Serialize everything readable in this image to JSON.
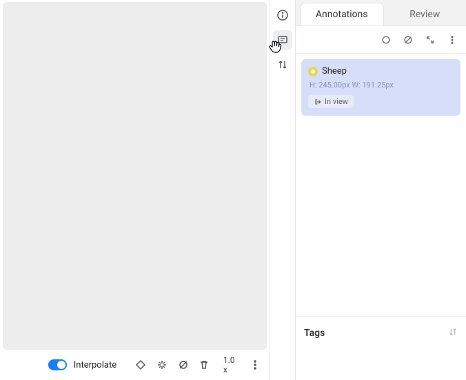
{
  "bottom": {
    "interpolate_label": "Interpolate",
    "zoom": "1.0 x"
  },
  "tabs": {
    "annotations": "Annotations",
    "review": "Review"
  },
  "annotation": {
    "name": "Sheep",
    "meta": "H: 245.00px W: 191.25px",
    "chip": "In view"
  },
  "tags": {
    "title": "Tags"
  }
}
